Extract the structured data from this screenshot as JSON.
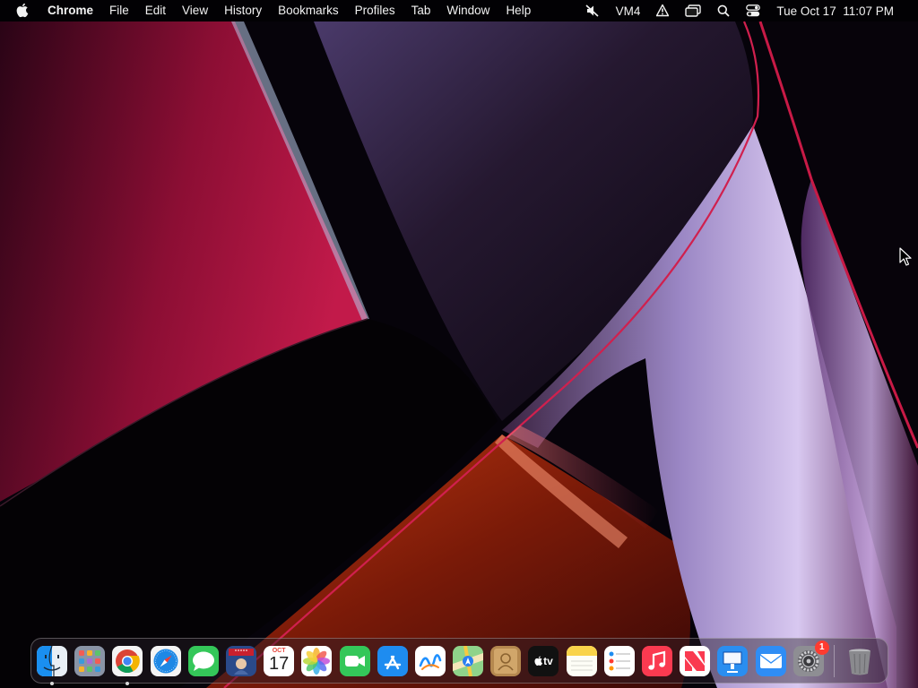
{
  "menubar": {
    "app_name": "Chrome",
    "menus": [
      "File",
      "Edit",
      "View",
      "History",
      "Bookmarks",
      "Profiles",
      "Tab",
      "Window",
      "Help"
    ],
    "status": {
      "vm_label": "VM4",
      "datetime": "Tue Oct 17  11:07 PM"
    },
    "icons": [
      "apple-logo-icon",
      "speaker-muted-icon",
      "alert-icon",
      "window-switcher-icon",
      "search-icon",
      "control-center-icon"
    ]
  },
  "dock": {
    "apps": [
      {
        "name": "Finder",
        "running": true
      },
      {
        "name": "Launchpad",
        "running": false
      },
      {
        "name": "Google Chrome",
        "running": true
      },
      {
        "name": "Safari",
        "running": false
      },
      {
        "name": "Messages",
        "running": false
      },
      {
        "name": "Photo Booth",
        "running": false
      },
      {
        "name": "Calendar",
        "running": false
      },
      {
        "name": "Photos",
        "running": false
      },
      {
        "name": "FaceTime",
        "running": false
      },
      {
        "name": "App Store",
        "running": false
      },
      {
        "name": "Freeform",
        "running": false
      },
      {
        "name": "Maps",
        "running": false
      },
      {
        "name": "Contacts",
        "running": false
      },
      {
        "name": "TV",
        "running": false
      },
      {
        "name": "Notes",
        "running": false
      },
      {
        "name": "Reminders",
        "running": false
      },
      {
        "name": "Music",
        "running": false
      },
      {
        "name": "News",
        "running": false
      },
      {
        "name": "Keynote",
        "running": false
      },
      {
        "name": "Mail",
        "running": false
      },
      {
        "name": "System Settings",
        "running": false
      }
    ],
    "calendar": {
      "month": "OCT",
      "day": "17"
    },
    "tv_label": "tv",
    "settings_badge": "1",
    "trash": "Trash"
  },
  "colors": {
    "menubar_text": "#f2f2f2",
    "wallpaper_crimson": "#b0123d",
    "wallpaper_lavender": "#c9b4e8",
    "wallpaper_orange": "#b2330d",
    "badge": "#ff3b30"
  }
}
